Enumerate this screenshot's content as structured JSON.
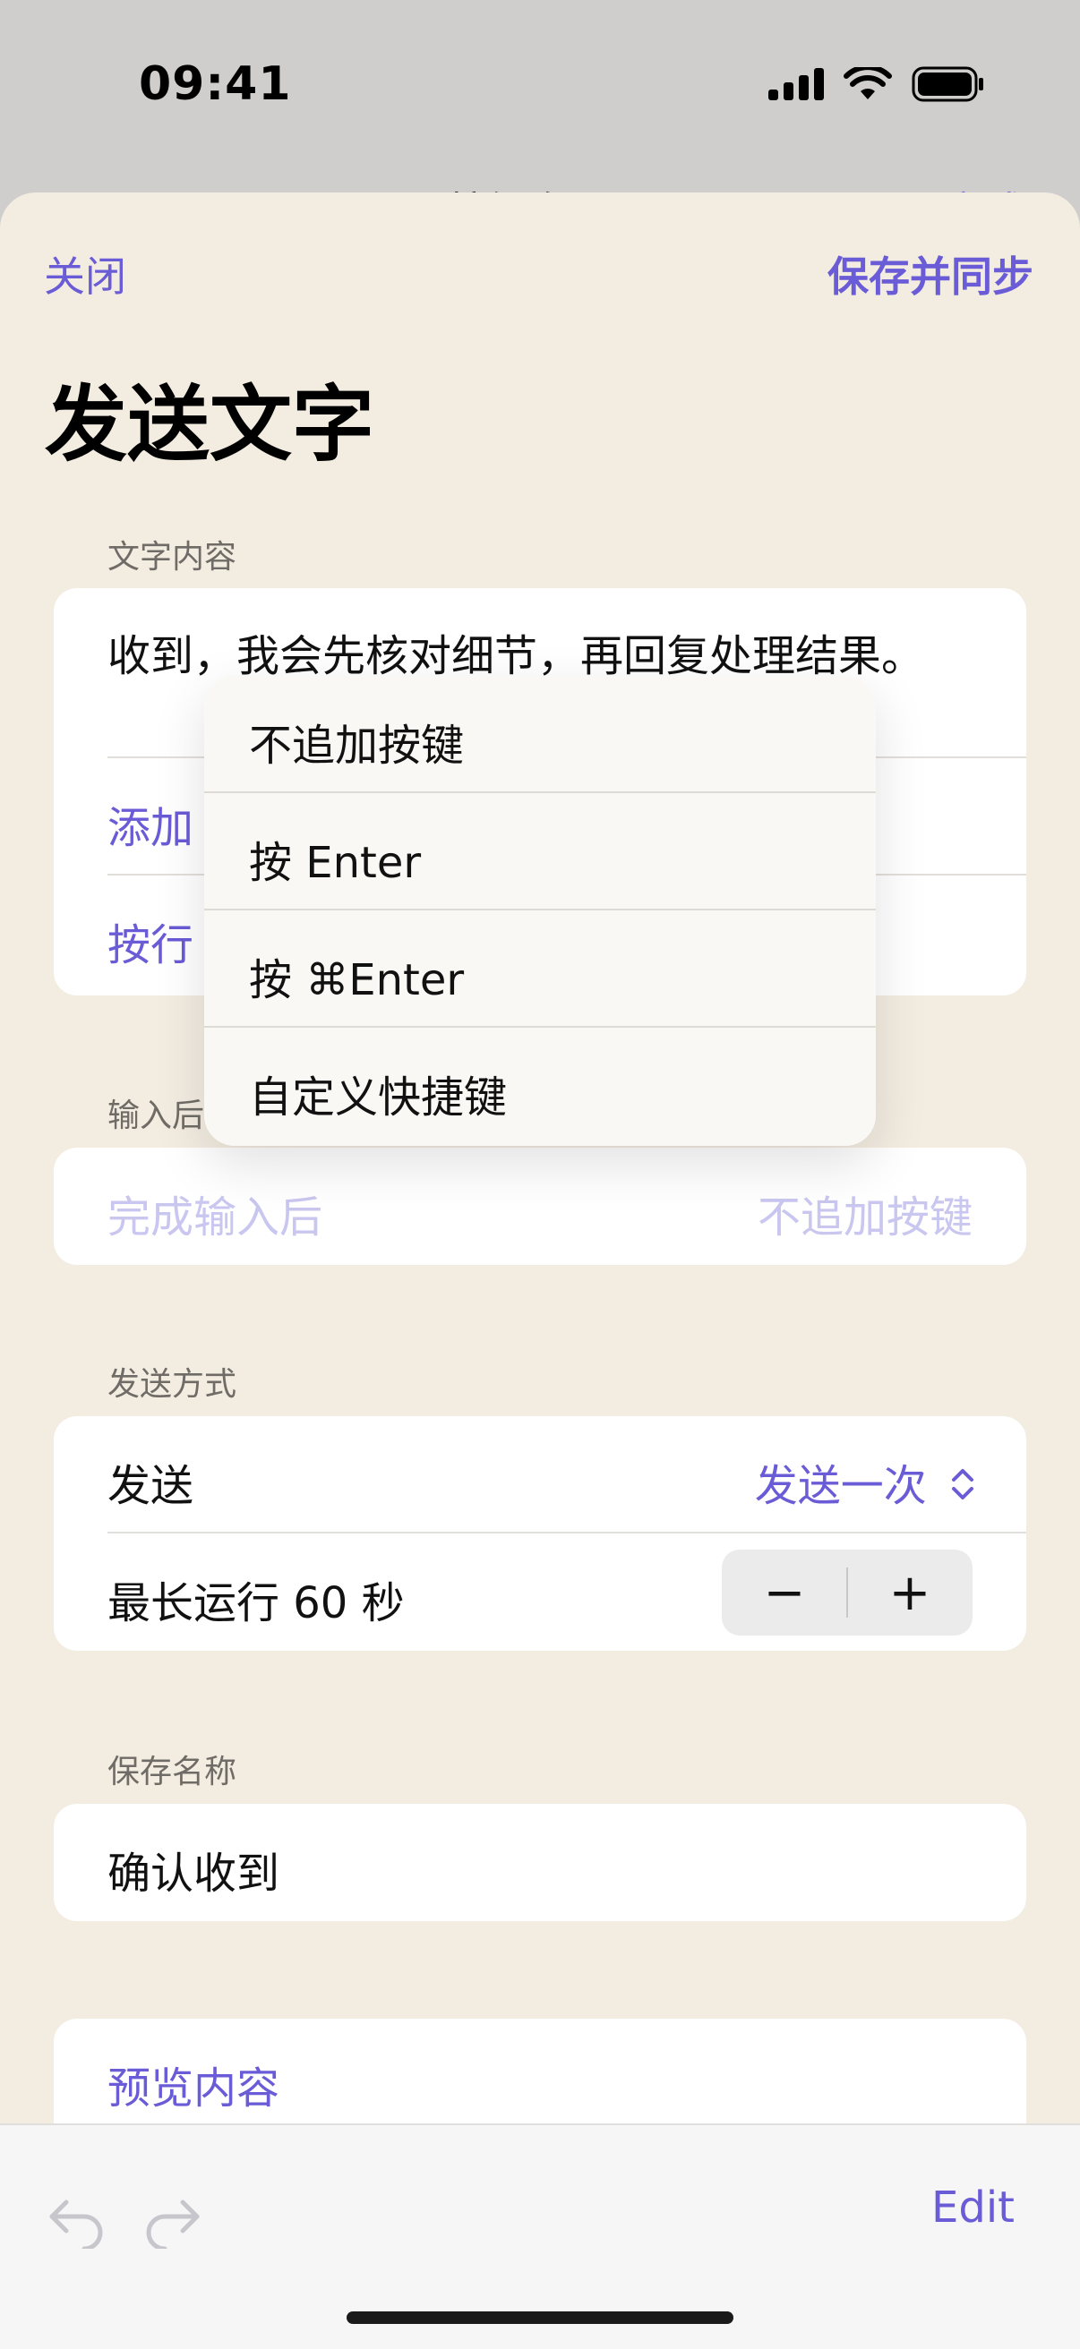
{
  "status": {
    "time": "09:41"
  },
  "nav": {
    "close": "关闭",
    "save": "保存并同步"
  },
  "page_title": "发送文字",
  "text_section": {
    "label": "文字内容",
    "content": "收到，我会先核对细节，再回复处理结果。",
    "row2": "添加",
    "row3": "按行"
  },
  "dropdown": {
    "items": [
      "不追加按键",
      "按 Enter",
      "按 ⌘Enter",
      "自定义快捷键"
    ]
  },
  "after_input": {
    "label": "输入后",
    "row_label": "完成输入后",
    "row_value": "不追加按键"
  },
  "send_section": {
    "label": "发送方式",
    "send_label": "发送",
    "send_value": "发送一次",
    "max_run_label": "最长运行 60 秒",
    "minus": "−",
    "plus": "+"
  },
  "save_name": {
    "label": "保存名称",
    "value": "确认收到"
  },
  "preview": {
    "label": "预览内容"
  },
  "toolbar": {
    "edit": "Edit"
  },
  "colors": {
    "accent": "#6a5bd6",
    "sheet_bg": "#f3ece1",
    "card_bg": "#ffffff"
  }
}
